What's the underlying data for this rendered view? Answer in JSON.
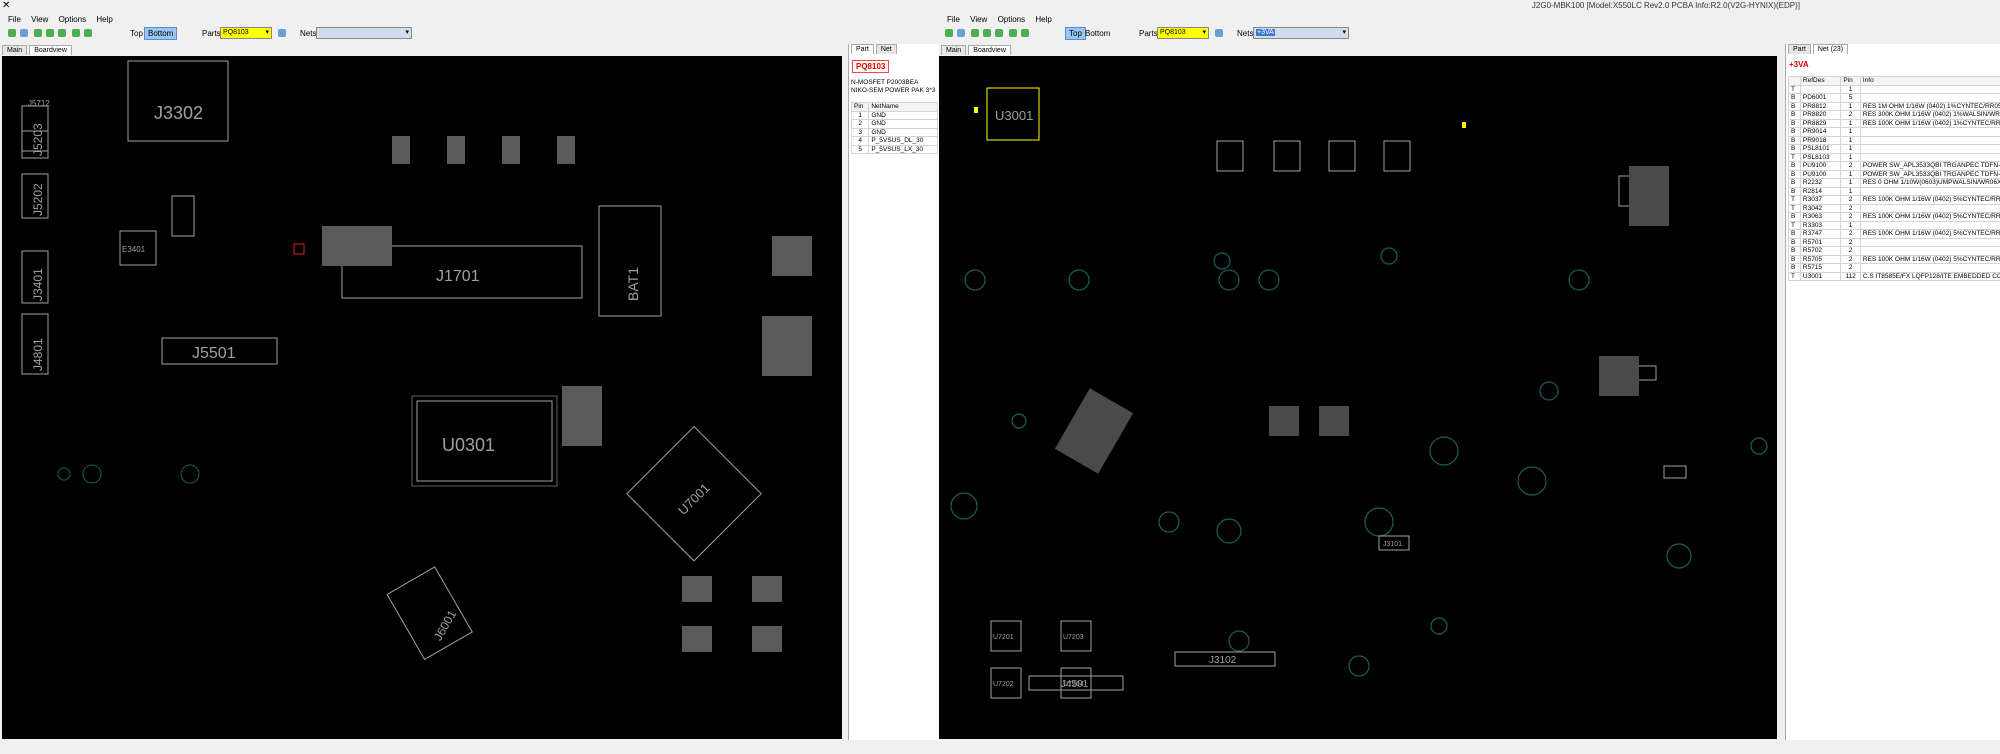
{
  "window": {
    "title": "J2G0-MBK100 [Model:X550LC Rev2.0 PCBA Info:R2.0(V2G-HYNIX)(EDP)]"
  },
  "left": {
    "menu": [
      "File",
      "View",
      "Options",
      "Help"
    ],
    "toolbar": {
      "top_label": "Top",
      "bottom_label": "Bottom",
      "parts_label": "Parts:",
      "parts_value": "PQ8103",
      "nets_label": "Nets:",
      "nets_value": ""
    },
    "tabs": [
      "Main",
      "Boardview"
    ],
    "side_tabs": [
      "Part",
      "Net"
    ],
    "part": {
      "name": "PQ8103",
      "desc1": "N-MOSFET P2003BEA",
      "desc2": "NIKO-SEM POWER PAK 3*3",
      "pin_header": [
        "Pin",
        "NetName"
      ],
      "pins": [
        [
          "1",
          "GND"
        ],
        [
          "2",
          "GND"
        ],
        [
          "3",
          "GND"
        ],
        [
          "4",
          "P_5VSUS_DL_30"
        ],
        [
          "5",
          "P_5VSUS_LX_30"
        ]
      ]
    },
    "board_labels": [
      "J3302",
      "J5203",
      "J5202",
      "J3401",
      "J4801",
      "J5501",
      "J1701",
      "BAT1",
      "U0301",
      "U7001",
      "J6001",
      "J5712",
      "E3401"
    ]
  },
  "right": {
    "menu": [
      "File",
      "View",
      "Options",
      "Help"
    ],
    "toolbar": {
      "top_label": "Top",
      "bottom_label": "Bottom",
      "parts_label": "Parts:",
      "parts_value": "PQ8103",
      "nets_label": "Nets:",
      "nets_value": "+3VA"
    },
    "tabs": [
      "Main",
      "Boardview"
    ],
    "side_tabs": [
      "Part",
      "Net (23)"
    ],
    "net": {
      "name": "+3VA",
      "header": [
        "",
        "RefDes",
        "Pin",
        "Info"
      ],
      "rows": [
        [
          "T",
          "",
          "1",
          ""
        ],
        [
          "B",
          "PD6001",
          "5",
          ""
        ],
        [
          "B",
          "PR8812",
          "1",
          "RES 1M OHM 1/16W (0402) 1%CYNTEC/RR0510..."
        ],
        [
          "B",
          "PR8820",
          "2",
          "RES 300K OHM 1/16W (0402) 1%WALSIN/WR04X..."
        ],
        [
          "B",
          "PR8829",
          "1",
          "RES 100K OHM 1/16W (0402) 1%CYNTEC/RR051..."
        ],
        [
          "B",
          "PR9014",
          "1",
          ""
        ],
        [
          "B",
          "PR9018",
          "1",
          ""
        ],
        [
          "B",
          "PSL8101",
          "1",
          ""
        ],
        [
          "T",
          "PSL8103",
          "1",
          ""
        ],
        [
          "B",
          "PU9100",
          "2",
          "POWER SW_APL3533QBI TRGANPEC TDFN-14A"
        ],
        [
          "B",
          "PU9100",
          "1",
          "POWER SW_APL3533QBI TRGANPEC TDFN-14A"
        ],
        [
          "B",
          "R2232",
          "1",
          "RES 0 OHM 1/10W(0603)UMPWALSIN/WR06X00..."
        ],
        [
          "B",
          "R2814",
          "1",
          ""
        ],
        [
          "T",
          "R3037",
          "2",
          "RES 100K OHM 1/16W (0402) 5%CYNTEC/RR051..."
        ],
        [
          "T",
          "R3042",
          "2",
          ""
        ],
        [
          "B",
          "R3063",
          "2",
          "RES 100K OHM 1/16W (0402) 5%CYNTEC/RR051..."
        ],
        [
          "T",
          "R3303",
          "1",
          ""
        ],
        [
          "B",
          "R3747",
          "2",
          "RES 100K OHM 1/16W (0402) 5%CYNTEC/RR051..."
        ],
        [
          "B",
          "R5701",
          "2",
          ""
        ],
        [
          "B",
          "R5702",
          "2",
          ""
        ],
        [
          "B",
          "R5705",
          "2",
          "RES 100K OHM 1/16W (0402) 5%CYNTEC/RR051..."
        ],
        [
          "B",
          "R5715",
          "2",
          ""
        ],
        [
          "T",
          "U3001",
          "112",
          "C.S IT8585E/FX LQFP128/ITE EMBEDDED CONTR..."
        ]
      ]
    },
    "board_labels": [
      "U3001",
      "J3102",
      "J4501",
      "J3101",
      "U7201",
      "U7202",
      "U7203",
      "U7204"
    ]
  },
  "colors": {
    "board_bg": "#000000",
    "outline": "#a0a0a0",
    "highlight": "#ffff00",
    "net_pin": "#1a5f5a",
    "selected_part": "#e02020"
  }
}
